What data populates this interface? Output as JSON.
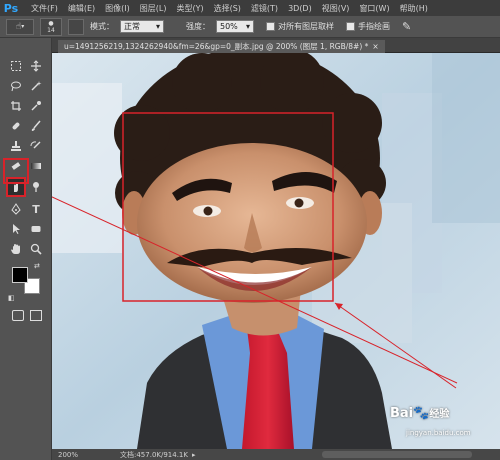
{
  "app": {
    "logo": "Ps"
  },
  "menu": [
    "文件(F)",
    "编辑(E)",
    "图像(I)",
    "图层(L)",
    "类型(Y)",
    "选择(S)",
    "滤镜(T)",
    "3D(D)",
    "视图(V)",
    "窗口(W)",
    "帮助(H)"
  ],
  "options": {
    "brush_size": "14",
    "mode_label": "模式：",
    "mode_value": "正常",
    "strength_label": "强度：",
    "strength_value": "50%",
    "sample_all_label": "对所有图层取样",
    "finger_paint_label": "手指绘画"
  },
  "document": {
    "tab_title": "u=1491256219,1324262940&fm=26&gp=0_副本.jpg @ 200% (图层 1, RGB/8#) *"
  },
  "status": {
    "zoom": "200%",
    "doc_size": "文档:457.0K/914.1K"
  },
  "watermark": {
    "brand": "Bai",
    "brand_suffix": "经验",
    "url": "jingyan.baidu.com"
  },
  "colors": {
    "highlight_red": "#d8232a",
    "accent_blue": "#31a8ff"
  }
}
